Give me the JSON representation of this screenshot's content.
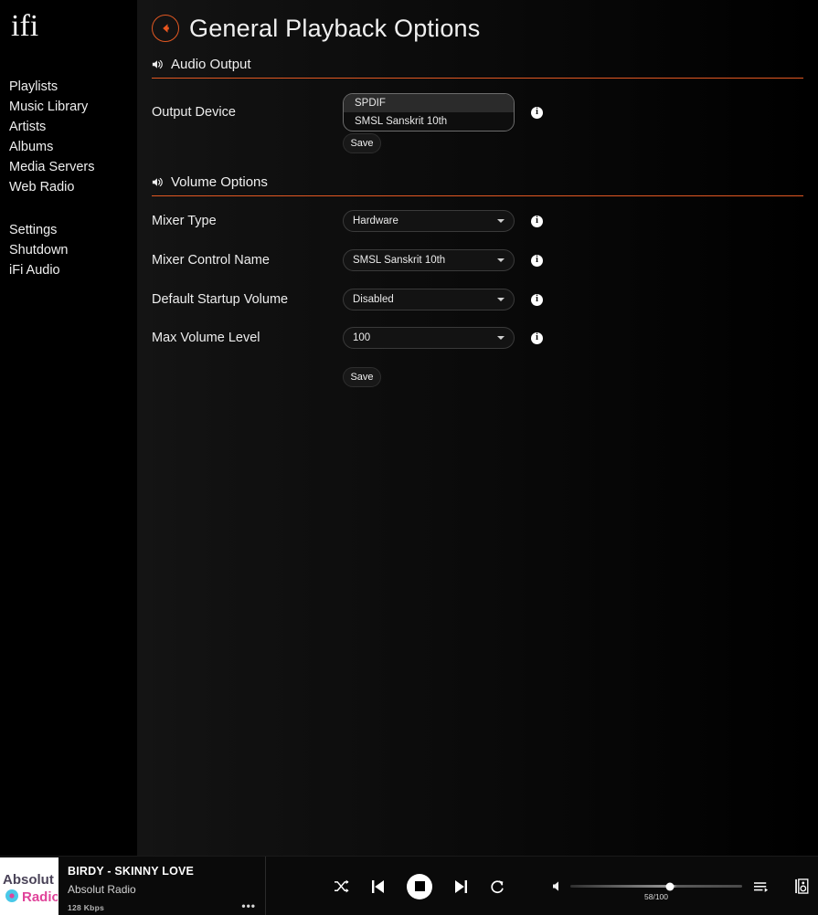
{
  "brand": {
    "logo_text": "ifi"
  },
  "sidebar": {
    "primary": [
      {
        "label": "Playlists"
      },
      {
        "label": "Music Library"
      },
      {
        "label": "Artists"
      },
      {
        "label": "Albums"
      },
      {
        "label": "Media Servers"
      },
      {
        "label": "Web Radio"
      }
    ],
    "secondary": [
      {
        "label": "Settings"
      },
      {
        "label": "Shutdown"
      },
      {
        "label": "iFi Audio"
      }
    ]
  },
  "header": {
    "title": "General Playback Options",
    "back_icon": "arrow-left-icon"
  },
  "sections": [
    {
      "id": "audio_output",
      "title": "Audio Output",
      "icon": "volume-icon"
    },
    {
      "id": "volume_options",
      "title": "Volume Options",
      "icon": "volume-icon"
    }
  ],
  "audio_output": {
    "output_device": {
      "label": "Output Device",
      "options": [
        "SPDIF",
        "SMSL Sanskrit 10th"
      ],
      "selected": "SPDIF",
      "info_icon": "info-icon"
    },
    "save_label": "Save"
  },
  "volume_options": {
    "fields": [
      {
        "label": "Mixer Type",
        "value": "Hardware",
        "info_icon": "info-icon"
      },
      {
        "label": "Mixer Control Name",
        "value": "SMSL Sanskrit 10th",
        "info_icon": "info-icon"
      },
      {
        "label": "Default Startup Volume",
        "value": "Disabled",
        "info_icon": "info-icon"
      },
      {
        "label": "Max Volume Level",
        "value": "100",
        "info_icon": "info-icon"
      }
    ],
    "save_label": "Save"
  },
  "player": {
    "album_art": {
      "line1": "Absolut",
      "line2": "Radio"
    },
    "title": "BIRDY - SKINNY LOVE",
    "subtitle": "Absolut Radio",
    "bitrate": "128 Kbps",
    "more_label": "•••",
    "transport": [
      {
        "name": "shuffle-icon"
      },
      {
        "name": "previous-icon"
      },
      {
        "name": "stop-icon"
      },
      {
        "name": "next-icon"
      },
      {
        "name": "repeat-icon"
      }
    ],
    "volume": {
      "icon": "speaker-icon",
      "label": "58/100",
      "value": 58,
      "max": 100
    },
    "right_icons": [
      {
        "name": "queue-icon"
      },
      {
        "name": "output-device-icon"
      }
    ]
  },
  "colors": {
    "accent": "#e25822",
    "background": "#000000",
    "text": "#eeeeee"
  }
}
